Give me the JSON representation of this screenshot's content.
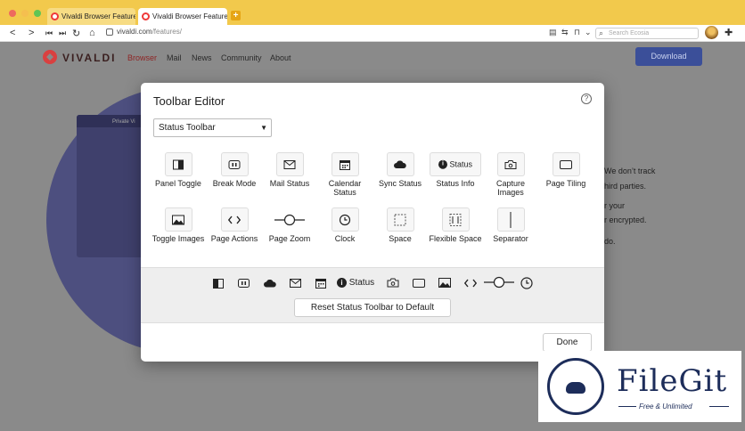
{
  "browser": {
    "tabs": [
      {
        "label": "Vivaldi Browser Features |",
        "active": false
      },
      {
        "label": "Vivaldi Browser Features |",
        "active": true
      }
    ],
    "url_domain": "vivaldi.com",
    "url_path": "/features/",
    "search_placeholder": "Search Ecosia"
  },
  "site": {
    "brand": "VIVALDI",
    "nav": [
      "Browser",
      "Mail",
      "News",
      "Community",
      "About"
    ],
    "download_label": "Download",
    "mini_tab_label": "Private Vi",
    "body_lines": [
      "We don’t track",
      "hird parties.",
      "r your",
      "r encrypted.",
      "do."
    ]
  },
  "dialog": {
    "title": "Toolbar Editor",
    "help_icon": "?",
    "select_value": "Status Toolbar",
    "items_row1": [
      {
        "label": "Panel Toggle",
        "icon": "panel-toggle-icon"
      },
      {
        "label": "Break Mode",
        "icon": "break-mode-icon"
      },
      {
        "label": "Mail Status",
        "icon": "mail-icon"
      },
      {
        "label": "Calendar Status",
        "icon": "calendar-icon"
      },
      {
        "label": "Sync Status",
        "icon": "cloud-icon"
      },
      {
        "label": "Status Info",
        "icon": "info-icon",
        "tile_text": "Status"
      },
      {
        "label": "Capture Images",
        "icon": "capture-icon"
      },
      {
        "label": "Page Tiling",
        "icon": "page-tiling-icon"
      }
    ],
    "items_row2": [
      {
        "label": "Toggle Images",
        "icon": "image-icon"
      },
      {
        "label": "Page Actions",
        "icon": "code-icon"
      },
      {
        "label": "Page Zoom",
        "icon": "zoom-slider-icon"
      },
      {
        "label": "Clock",
        "icon": "clock-icon"
      },
      {
        "label": "Space",
        "icon": "space-icon"
      },
      {
        "label": "Flexible Space",
        "icon": "flexible-space-icon"
      },
      {
        "label": "Separator",
        "icon": "separator-icon"
      }
    ],
    "preview_status_text": "Status",
    "reset_label": "Reset Status Toolbar to Default",
    "done_label": "Done"
  },
  "watermark": {
    "title": "FileGit",
    "subtitle": "Free & Unlimited"
  },
  "colors": {
    "chrome": "#f2c94c",
    "overlay_page": "#8a8a8a",
    "download_button": "#3b4f99",
    "watermark_navy": "#1d2d5a"
  }
}
